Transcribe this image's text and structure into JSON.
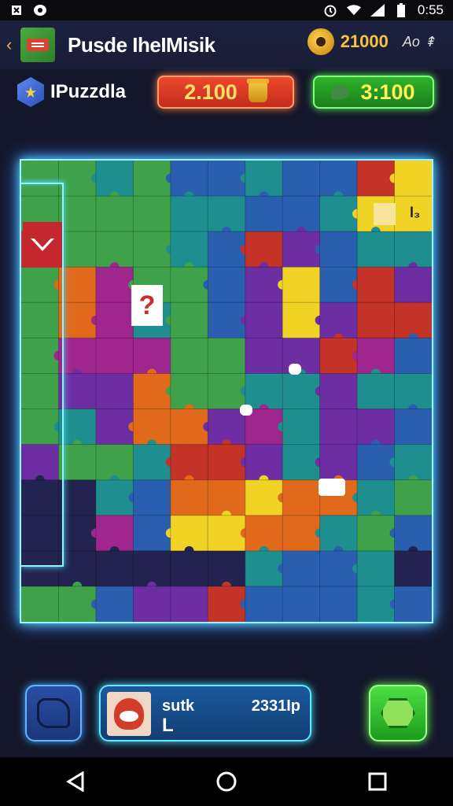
{
  "status_bar": {
    "time": "0:55",
    "left_icons": [
      "usb-icon",
      "notification-icon"
    ],
    "right_icons": [
      "alarm-icon",
      "wifi-icon",
      "signal-icon",
      "battery-icon"
    ]
  },
  "header": {
    "back_icon": "back-arrow-icon",
    "title": "Pusde IheIMisik",
    "coins": "21000",
    "sound_label": "Ao ⇞"
  },
  "info": {
    "puzzle_name": "IPuzzdla",
    "score": "2.100",
    "time": "3:100"
  },
  "board": {
    "piece_label": "l₃",
    "marker_symbol": "?",
    "colors": {
      "green": "#3fa24a",
      "teal": "#1f8e8e",
      "blue": "#2a5fb0",
      "purple": "#6e2ea3",
      "magenta": "#a0268f",
      "red": "#c33328",
      "orange": "#e0691c",
      "yellow": "#f1d326",
      "dark": "#23234f"
    }
  },
  "player": {
    "name": "sutk",
    "level": "L",
    "points": "2331Ip"
  },
  "colors": {
    "background": "#14172b",
    "neon_cyan": "#4fd8ff",
    "score_red": "#ef4a2e",
    "time_green": "#2fb52a",
    "coin_gold": "#f6c342"
  }
}
